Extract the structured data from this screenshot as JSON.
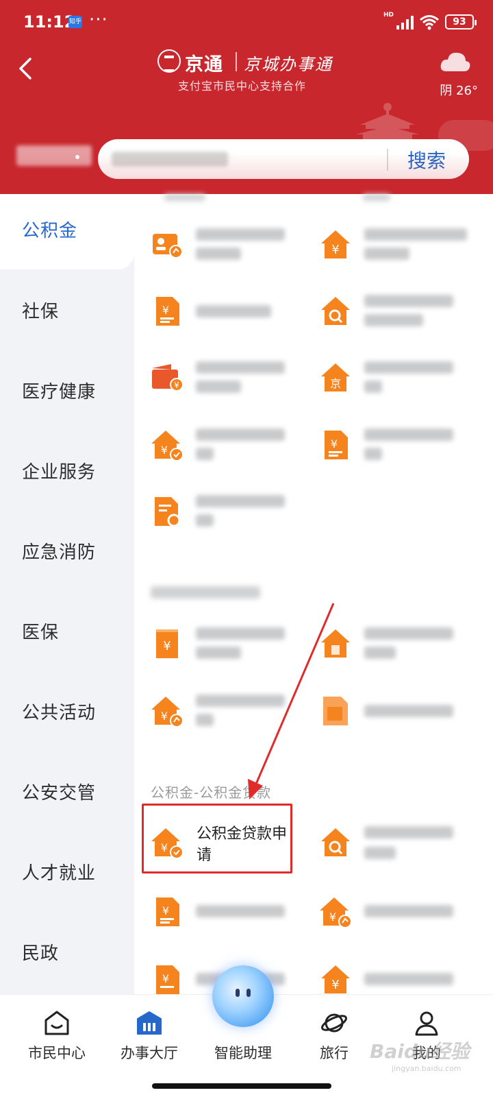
{
  "status_bar": {
    "time": "11:12",
    "app_badge": "知乎",
    "more": "···",
    "network": "HD",
    "battery": "93"
  },
  "header": {
    "brand_name": "京通",
    "brand_calligraphy": "京城办事通",
    "subtitle": "支付宝市民中心支持合作",
    "weather": "阴 26°"
  },
  "search": {
    "button_label": "搜索"
  },
  "sidebar": {
    "items": [
      {
        "label": "公积金",
        "active": true
      },
      {
        "label": "社保"
      },
      {
        "label": "医疗健康"
      },
      {
        "label": "企业服务"
      },
      {
        "label": "应急消防"
      },
      {
        "label": "医保"
      },
      {
        "label": "公共活动"
      },
      {
        "label": "公安交管"
      },
      {
        "label": "人才就业"
      },
      {
        "label": "民政"
      }
    ]
  },
  "content": {
    "loan_section_title": "公积金-公积金贷款",
    "highlighted_service": "公积金贷款申请"
  },
  "bottom_nav": {
    "items": [
      {
        "label": "市民中心",
        "icon": "home-smile-icon"
      },
      {
        "label": "办事大厅",
        "icon": "hall-icon",
        "active": true
      },
      {
        "label": "智能助理",
        "icon": "assistant-orb-icon"
      },
      {
        "label": "旅行",
        "icon": "planet-icon"
      },
      {
        "label": "我的",
        "icon": "person-icon"
      }
    ]
  },
  "watermark": {
    "text": "Baidu经验",
    "sub": "jingyan.baidu.com"
  },
  "colors": {
    "header_red": "#c8272e",
    "accent_blue": "#2667cc",
    "icon_orange": "#f5841f",
    "highlight_red": "#e02b2b"
  }
}
